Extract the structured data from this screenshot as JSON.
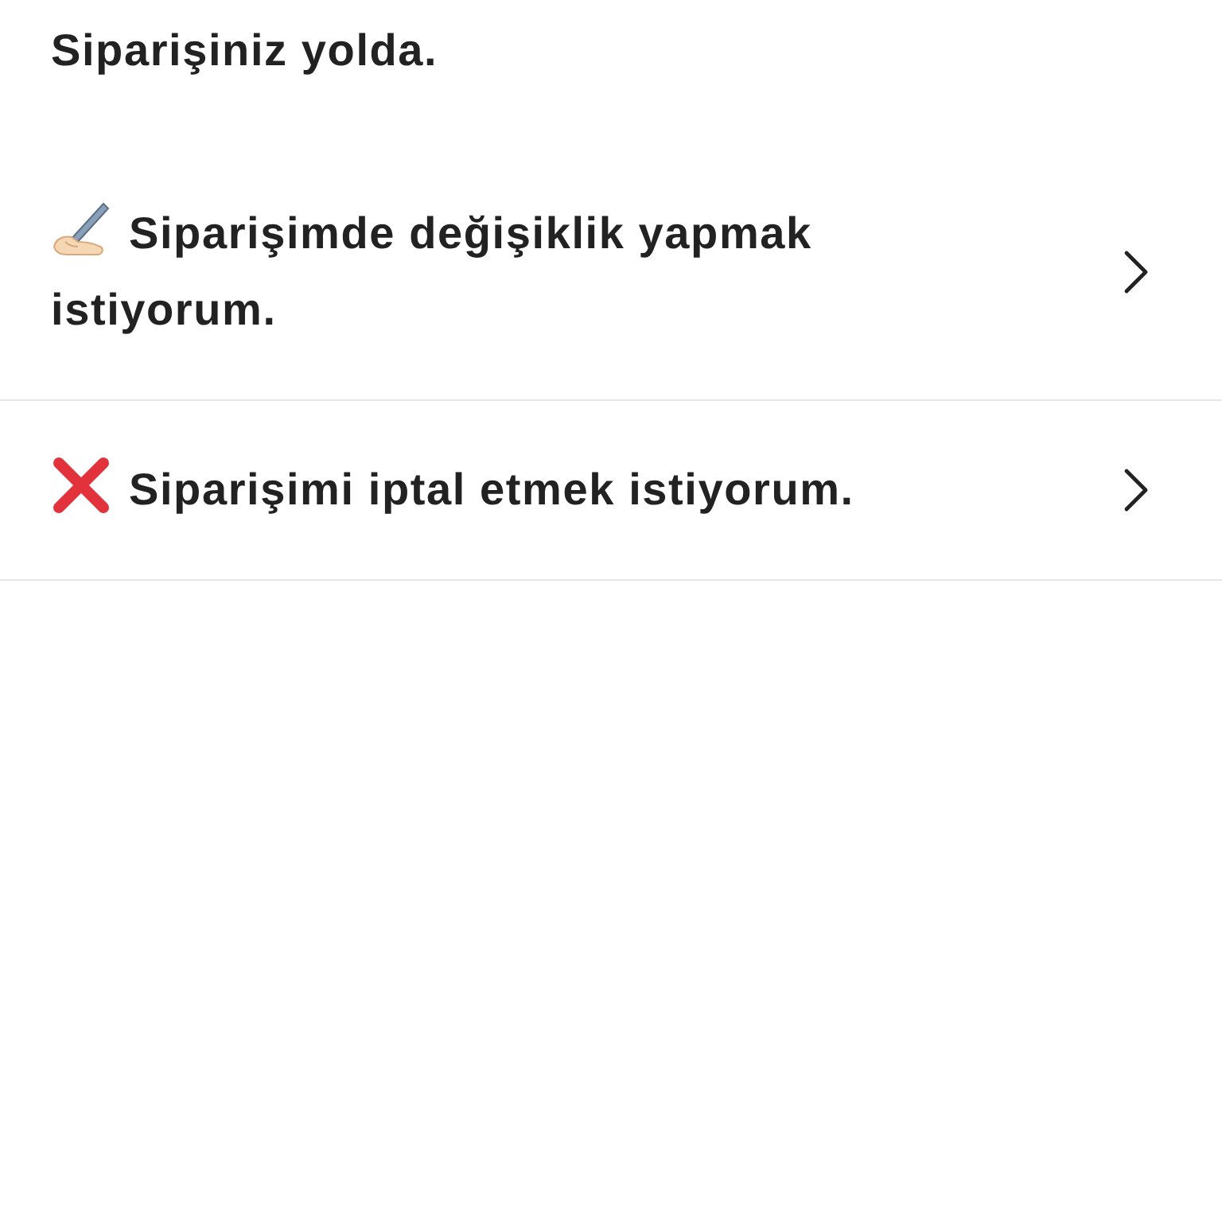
{
  "status_message": "Siparişiniz yolda.",
  "options": [
    {
      "kind": "edit",
      "label": "Siparişimde değişiklik yapmak istiyorum."
    },
    {
      "kind": "cancel",
      "label": "Siparişimi iptal etmek istiyorum."
    }
  ]
}
